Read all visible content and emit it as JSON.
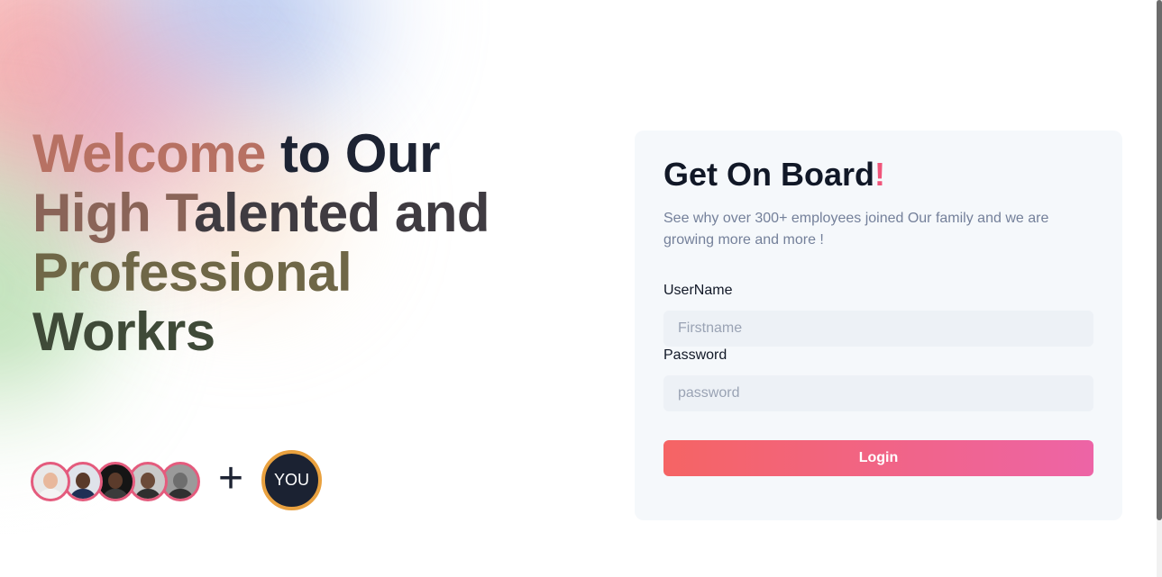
{
  "hero": {
    "line1_a": "Welcome",
    "line1_b": " to Our",
    "line2_a": "High T",
    "line2_b": "alented and",
    "line3": "Professional",
    "line4": "Workrs"
  },
  "avatars": [
    {
      "name": "avatar-1",
      "skin": "#e8b89c",
      "shirt": "#f4f4f4",
      "bg": "#e9e9e9"
    },
    {
      "name": "avatar-2",
      "skin": "#5a3a2a",
      "shirt": "#1f2f55",
      "bg": "#dfe3ea"
    },
    {
      "name": "avatar-3",
      "skin": "#5b3b2b",
      "shirt": "#3b3b3b",
      "bg": "#151515"
    },
    {
      "name": "avatar-4",
      "skin": "#6b4a38",
      "shirt": "#2f2f2f",
      "bg": "#c9c9c9"
    },
    {
      "name": "avatar-5",
      "skin": "#6e6e6e",
      "shirt": "#303030",
      "bg": "#9a9a9a"
    }
  ],
  "plus_symbol": "+",
  "you_badge": "YOU",
  "card": {
    "title": "Get On Board",
    "title_mark": "!",
    "subtitle": "See why over 300+ employees joined Our family and we are growing more and more !",
    "username_label": "UserName",
    "username_placeholder": "Firstname",
    "password_label": "Password",
    "password_placeholder": "password",
    "login_label": "Login"
  },
  "colors": {
    "accent_start": "#f56464",
    "accent_end": "#ed64a6",
    "avatar_ring": "#e45b7d",
    "you_ring": "#e9a13f"
  }
}
